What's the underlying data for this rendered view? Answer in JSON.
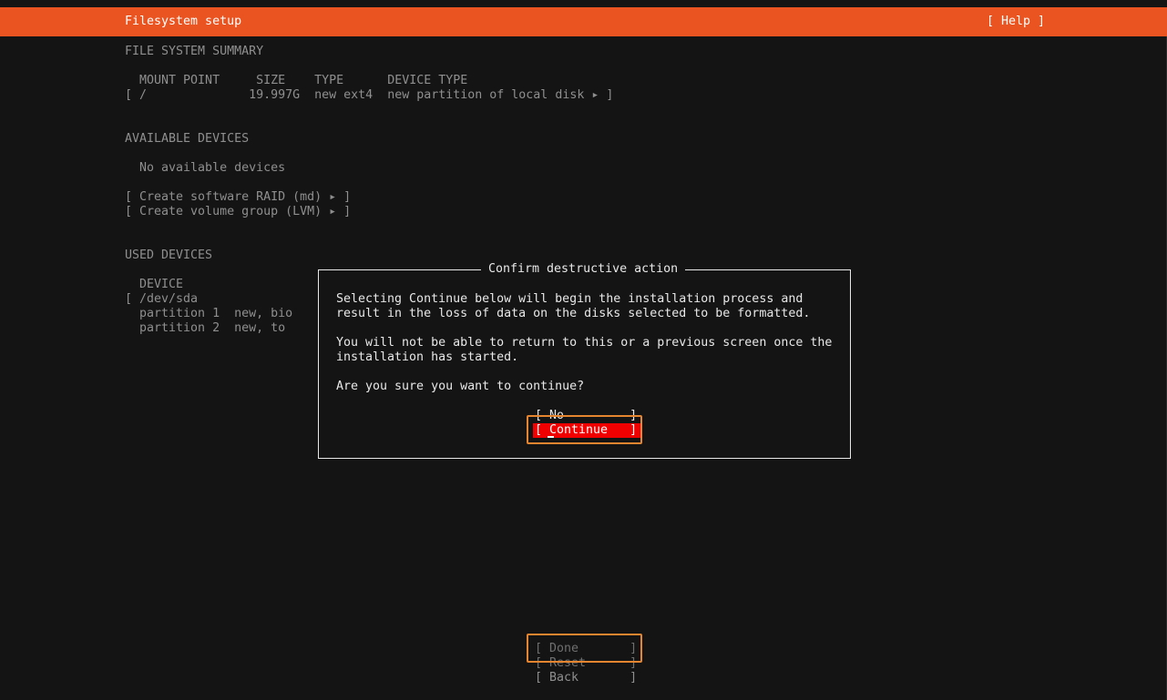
{
  "titlebar": {
    "title": "Filesystem setup",
    "help": "[ Help ]"
  },
  "summary": {
    "heading": "FILE SYSTEM SUMMARY",
    "columns": "  MOUNT POINT     SIZE    TYPE      DEVICE TYPE",
    "row": "[ /              19.997G  new ext4  new partition of local disk ▸ ]"
  },
  "available": {
    "heading": "AVAILABLE DEVICES",
    "empty": "  No available devices",
    "raid": "[ Create software RAID (md) ▸ ]",
    "lvm": "[ Create volume group (LVM) ▸ ]"
  },
  "used": {
    "heading": "USED DEVICES",
    "columns": "  DEVICE",
    "rows": [
      "[ /dev/sda",
      "  partition 1  new, bio",
      "  partition 2  new, to"
    ]
  },
  "dialog": {
    "title": "Confirm destructive action",
    "lines": [
      "Selecting Continue below will begin the installation process and",
      "result in the loss of data on the disks selected to be formatted.",
      "You will not be able to return to this or a previous screen once the",
      "installation has started.",
      "Are you sure you want to continue?"
    ],
    "no_label": "[ No         ]",
    "continue_label": "[ Continue   ]"
  },
  "footer": {
    "done_label": "[ Done       ]",
    "reset_label": "[ Reset      ]",
    "back_label": "[ Back       ]"
  },
  "colors": {
    "accent": "#e95420",
    "danger": "#f00000",
    "highlight": "#e5852f",
    "background": "#141414"
  }
}
